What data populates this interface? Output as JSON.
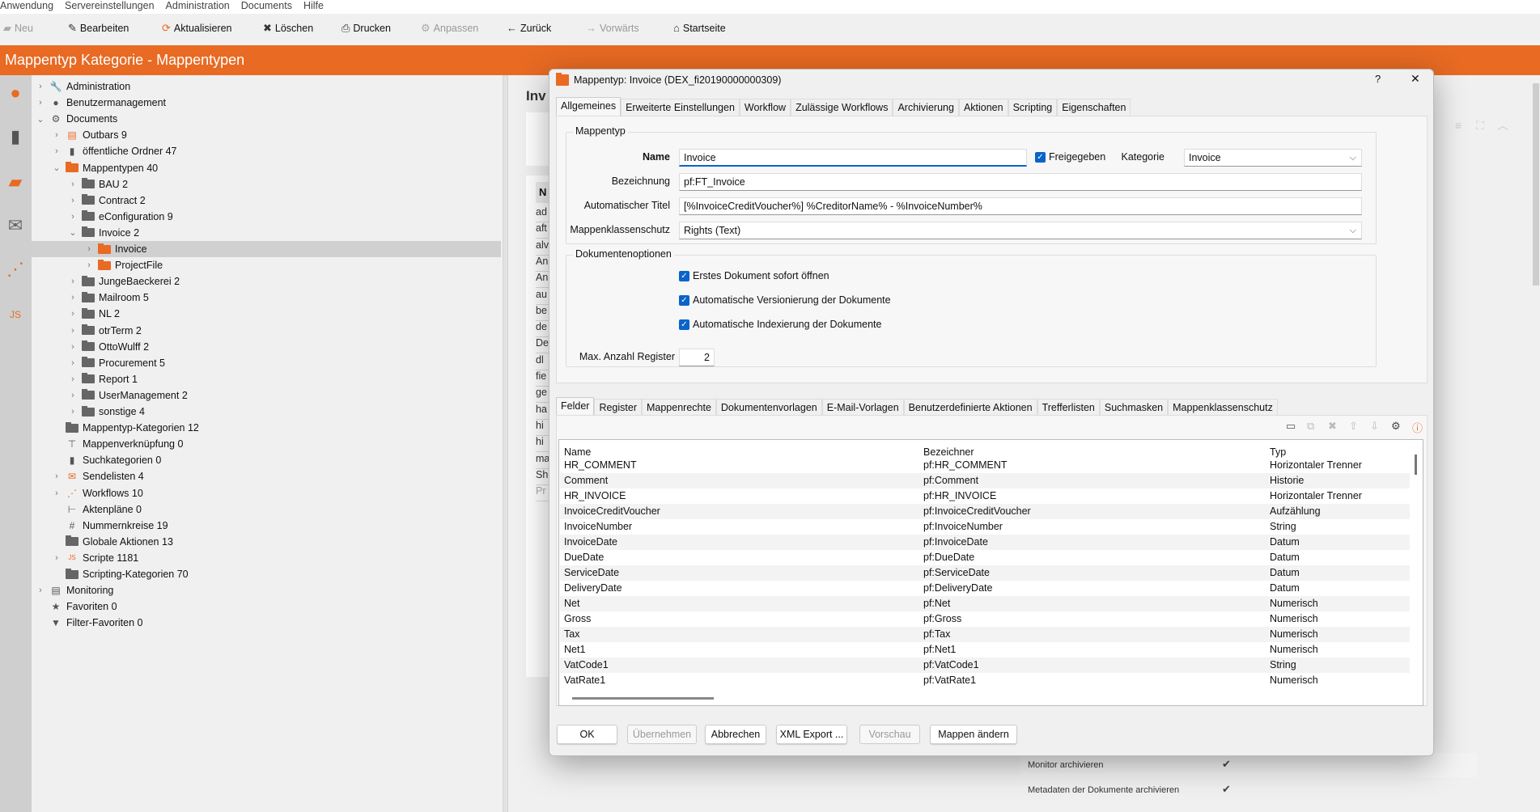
{
  "menu": [
    "Anwendung",
    "Servereinstellungen",
    "Administration",
    "Documents",
    "Hilfe"
  ],
  "toolbar": [
    {
      "label": "Neu",
      "icon": "folder-icon",
      "disabled": true
    },
    {
      "label": "Bearbeiten",
      "icon": "edit-icon",
      "disabled": false
    },
    {
      "label": "Aktualisieren",
      "icon": "refresh-icon",
      "disabled": false
    },
    {
      "label": "Löschen",
      "icon": "delete-icon",
      "disabled": false
    },
    {
      "label": "Drucken",
      "icon": "print-icon",
      "disabled": false
    },
    {
      "label": "Anpassen",
      "icon": "gear-icon",
      "disabled": true
    },
    {
      "label": "Zurück",
      "icon": "arrow-left-icon",
      "disabled": false
    },
    {
      "label": "Vorwärts",
      "icon": "arrow-right-icon",
      "disabled": true
    },
    {
      "label": "Startseite",
      "icon": "home-icon",
      "disabled": false
    }
  ],
  "header": {
    "title": "Mappentyp Kategorie - Mappentypen"
  },
  "accent": "#e86a23",
  "tree": [
    {
      "label": "Administration",
      "level": 0,
      "exp": "c",
      "icon": "wrench"
    },
    {
      "label": "Benutzermanagement",
      "level": 0,
      "exp": "c",
      "icon": "user"
    },
    {
      "label": "Documents",
      "level": 0,
      "exp": "o",
      "icon": "gear"
    },
    {
      "label": "Outbars  9",
      "level": 1,
      "exp": "c",
      "icon": "outbar"
    },
    {
      "label": "öffentliche Ordner  47",
      "level": 1,
      "exp": "c",
      "icon": "binder"
    },
    {
      "label": "Mappentypen  40",
      "level": 1,
      "exp": "o",
      "icon": "ofolder"
    },
    {
      "label": "BAU 2",
      "level": 2,
      "exp": "c",
      "icon": "folder"
    },
    {
      "label": "Contract 2",
      "level": 2,
      "exp": "c",
      "icon": "folder"
    },
    {
      "label": "eConfiguration 9",
      "level": 2,
      "exp": "c",
      "icon": "folder"
    },
    {
      "label": "Invoice 2",
      "level": 2,
      "exp": "o",
      "icon": "folder"
    },
    {
      "label": "Invoice",
      "level": 3,
      "exp": "c",
      "icon": "ofolder",
      "selected": true
    },
    {
      "label": "ProjectFile",
      "level": 3,
      "exp": "c",
      "icon": "ofolder"
    },
    {
      "label": "JungeBaeckerei 2",
      "level": 2,
      "exp": "c",
      "icon": "folder"
    },
    {
      "label": "Mailroom 5",
      "level": 2,
      "exp": "c",
      "icon": "folder"
    },
    {
      "label": "NL 2",
      "level": 2,
      "exp": "c",
      "icon": "folder"
    },
    {
      "label": "otrTerm 2",
      "level": 2,
      "exp": "c",
      "icon": "folder"
    },
    {
      "label": "OttoWulff 2",
      "level": 2,
      "exp": "c",
      "icon": "folder"
    },
    {
      "label": "Procurement 5",
      "level": 2,
      "exp": "c",
      "icon": "folder"
    },
    {
      "label": "Report 1",
      "level": 2,
      "exp": "c",
      "icon": "folder"
    },
    {
      "label": "UserManagement 2",
      "level": 2,
      "exp": "c",
      "icon": "folder"
    },
    {
      "label": "sonstige  4",
      "level": 2,
      "exp": "c",
      "icon": "folder"
    },
    {
      "label": "Mappentyp-Kategorien  12",
      "level": 1,
      "exp": "",
      "icon": "folder"
    },
    {
      "label": "Mappenverknüpfung  0",
      "level": 1,
      "exp": "",
      "icon": "hierarchy"
    },
    {
      "label": "Suchkategorien  0",
      "level": 1,
      "exp": "",
      "icon": "binder"
    },
    {
      "label": "Sendelisten  4",
      "level": 1,
      "exp": "c",
      "icon": "mail"
    },
    {
      "label": "Workflows  10",
      "level": 1,
      "exp": "c",
      "icon": "workflow"
    },
    {
      "label": "Aktenpläne  0",
      "level": 1,
      "exp": "",
      "icon": "tree"
    },
    {
      "label": "Nummernkreise  19",
      "level": 1,
      "exp": "",
      "icon": "hash"
    },
    {
      "label": "Globale Aktionen  13",
      "level": 1,
      "exp": "",
      "icon": "folder"
    },
    {
      "label": "Scripte  1181",
      "level": 1,
      "exp": "c",
      "icon": "script"
    },
    {
      "label": "Scripting-Kategorien  70",
      "level": 1,
      "exp": "",
      "icon": "folder"
    },
    {
      "label": "Monitoring",
      "level": 0,
      "exp": "c",
      "icon": "server"
    },
    {
      "label": "Favoriten  0",
      "level": 0,
      "exp": "",
      "icon": "star"
    },
    {
      "label": "Filter-Favoriten  0",
      "level": 0,
      "exp": "",
      "icon": "filter"
    }
  ],
  "background": {
    "heading": "Inv",
    "col_header": "N",
    "items": [
      "ad",
      "aft",
      "alv",
      "An",
      "An",
      "au",
      "be",
      "de",
      "De",
      "dl",
      "fie",
      "ge",
      "ha",
      "hi",
      "hi",
      "ma",
      "Sh",
      "Pr"
    ],
    "right_rows": [
      {
        "label": "Monitor archivieren",
        "checked": true
      },
      {
        "label": "Metadaten der Dokumente archivieren",
        "checked": true
      }
    ]
  },
  "dialog": {
    "title": "Mappentyp:  Invoice (DEX_fi20190000000309)",
    "help": "?",
    "close": "✕",
    "tabs": [
      "Allgemeines",
      "Erweiterte Einstellungen",
      "Workflow",
      "Zulässige Workflows",
      "Archivierung",
      "Aktionen",
      "Scripting",
      "Eigenschaften"
    ],
    "group1": "Mappentyp",
    "name_label": "Name",
    "name_value": "Invoice",
    "freigegeben": "Freigegeben",
    "kategorie_label": "Kategorie",
    "kategorie_value": "Invoice",
    "bez_label": "Bezeichnung",
    "bez_value": "pf:FT_Invoice",
    "titel_label": "Automatischer Titel",
    "titel_value": "[%InvoiceCreditVoucher%] %CreditorName% - %InvoiceNumber%",
    "schutz_label": "Mappenklassenschutz",
    "schutz_value": "Rights (Text)",
    "group2": "Dokumentenoptionen",
    "options": [
      "Erstes Dokument sofort öffnen",
      "Automatische Versionierung der Dokumente",
      "Automatische Indexierung der Dokumente"
    ],
    "max_label": "Max. Anzahl  Register",
    "max_value": "2",
    "subtabs": [
      "Felder",
      "Register",
      "Mappenrechte",
      "Dokumentenvorlagen",
      "E-Mail-Vorlagen",
      "Benutzerdefinierte Aktionen",
      "Trefferlisten",
      "Suchmasken",
      "Mappenklassenschutz"
    ],
    "columns": [
      "Name",
      "Bezeichner",
      "Typ"
    ],
    "rows": [
      [
        "HR_COMMENT",
        "pf:HR_COMMENT",
        "Horizontaler Trenner"
      ],
      [
        "Comment",
        "pf:Comment",
        "Historie"
      ],
      [
        "HR_INVOICE",
        "pf:HR_INVOICE",
        "Horizontaler Trenner"
      ],
      [
        "InvoiceCreditVoucher",
        "pf:InvoiceCreditVoucher",
        "Aufzählung"
      ],
      [
        "InvoiceNumber",
        "pf:InvoiceNumber",
        "String"
      ],
      [
        "InvoiceDate",
        "pf:InvoiceDate",
        "Datum"
      ],
      [
        "DueDate",
        "pf:DueDate",
        "Datum"
      ],
      [
        "ServiceDate",
        "pf:ServiceDate",
        "Datum"
      ],
      [
        "DeliveryDate",
        "pf:DeliveryDate",
        "Datum"
      ],
      [
        "Net",
        "pf:Net",
        "Numerisch"
      ],
      [
        "Gross",
        "pf:Gross",
        "Numerisch"
      ],
      [
        "Tax",
        "pf:Tax",
        "Numerisch"
      ],
      [
        "Net1",
        "pf:Net1",
        "Numerisch"
      ],
      [
        "VatCode1",
        "pf:VatCode1",
        "String"
      ],
      [
        "VatRate1",
        "pf:VatRate1",
        "Numerisch"
      ]
    ],
    "buttons": [
      {
        "label": "OK",
        "disabled": false
      },
      {
        "label": "Übernehmen",
        "disabled": true
      },
      {
        "label": "Abbrechen",
        "disabled": false
      },
      {
        "label": "XML Export ...",
        "disabled": false
      },
      {
        "label": "Vorschau",
        "disabled": true
      },
      {
        "label": "Mappen ändern",
        "disabled": false
      }
    ]
  }
}
